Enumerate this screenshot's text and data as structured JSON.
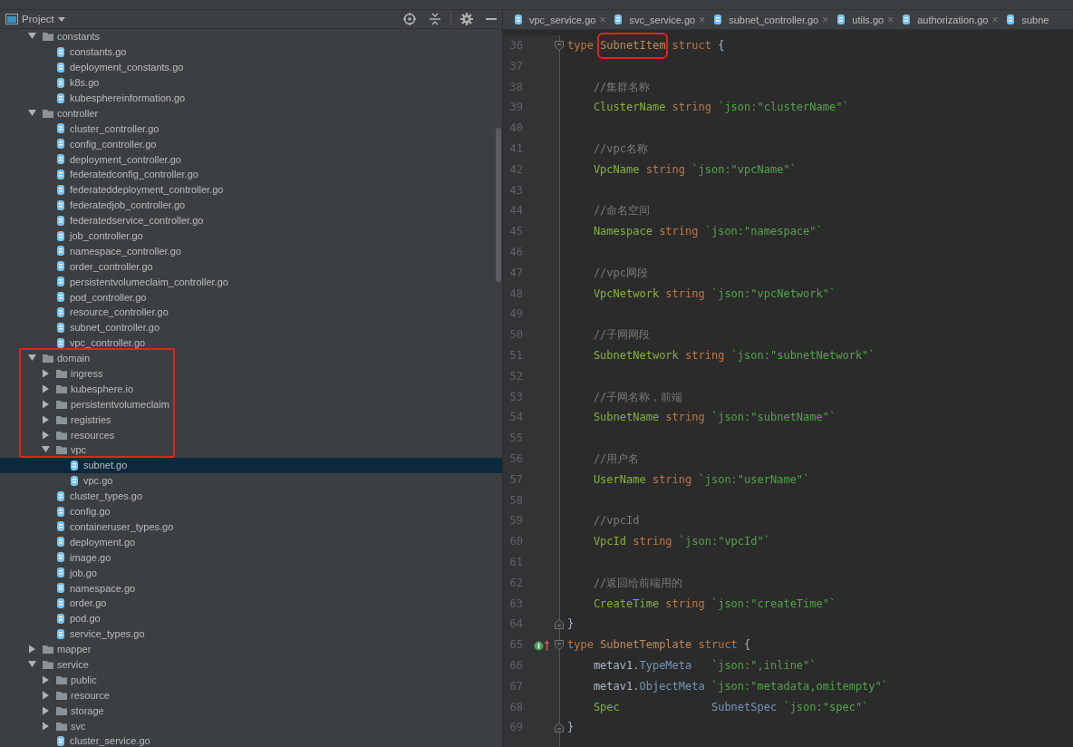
{
  "project_panel": {
    "title": "Project",
    "tree": [
      {
        "kind": "folder",
        "name": "constants",
        "expanded": true,
        "selected": false,
        "boxed": false,
        "children": [
          {
            "kind": "file",
            "name": "constants.go",
            "selected": false
          },
          {
            "kind": "file",
            "name": "deployment_constants.go",
            "selected": false
          },
          {
            "kind": "file",
            "name": "k8s.go",
            "selected": false
          },
          {
            "kind": "file",
            "name": "kubesphereinformation.go",
            "selected": false
          }
        ]
      },
      {
        "kind": "folder",
        "name": "controller",
        "expanded": true,
        "selected": false,
        "boxed": false,
        "children": [
          {
            "kind": "file",
            "name": "cluster_controller.go",
            "selected": false
          },
          {
            "kind": "file",
            "name": "config_controller.go",
            "selected": false
          },
          {
            "kind": "file",
            "name": "deployment_controller.go",
            "selected": false
          },
          {
            "kind": "file",
            "name": "federatedconfig_controller.go",
            "selected": false
          },
          {
            "kind": "file",
            "name": "federateddeployment_controller.go",
            "selected": false
          },
          {
            "kind": "file",
            "name": "federatedjob_controller.go",
            "selected": false
          },
          {
            "kind": "file",
            "name": "federatedservice_controller.go",
            "selected": false
          },
          {
            "kind": "file",
            "name": "job_controller.go",
            "selected": false
          },
          {
            "kind": "file",
            "name": "namespace_controller.go",
            "selected": false
          },
          {
            "kind": "file",
            "name": "order_controller.go",
            "selected": false
          },
          {
            "kind": "file",
            "name": "persistentvolumeclaim_controller.go",
            "selected": false
          },
          {
            "kind": "file",
            "name": "pod_controller.go",
            "selected": false
          },
          {
            "kind": "file",
            "name": "resource_controller.go",
            "selected": false
          },
          {
            "kind": "file",
            "name": "subnet_controller.go",
            "selected": false
          },
          {
            "kind": "file",
            "name": "vpc_controller.go",
            "selected": false
          }
        ]
      },
      {
        "kind": "folder",
        "name": "domain",
        "expanded": true,
        "selected": false,
        "boxed": true,
        "children": [
          {
            "kind": "folder",
            "name": "ingress",
            "expanded": false,
            "selected": false
          },
          {
            "kind": "folder",
            "name": "kubesphere.io",
            "expanded": false,
            "selected": false
          },
          {
            "kind": "folder",
            "name": "persistentvolumeclaim",
            "expanded": false,
            "selected": false
          },
          {
            "kind": "folder",
            "name": "registries",
            "expanded": false,
            "selected": false
          },
          {
            "kind": "folder",
            "name": "resources",
            "expanded": false,
            "selected": false
          },
          {
            "kind": "folder",
            "name": "vpc",
            "expanded": true,
            "selected": false,
            "children": [
              {
                "kind": "file",
                "name": "subnet.go",
                "selected": true
              },
              {
                "kind": "file",
                "name": "vpc.go",
                "selected": false
              }
            ]
          },
          {
            "kind": "file",
            "name": "cluster_types.go",
            "selected": false
          },
          {
            "kind": "file",
            "name": "config.go",
            "selected": false
          },
          {
            "kind": "file",
            "name": "containeruser_types.go",
            "selected": false
          },
          {
            "kind": "file",
            "name": "deployment.go",
            "selected": false
          },
          {
            "kind": "file",
            "name": "image.go",
            "selected": false
          },
          {
            "kind": "file",
            "name": "job.go",
            "selected": false
          },
          {
            "kind": "file",
            "name": "namespace.go",
            "selected": false
          },
          {
            "kind": "file",
            "name": "order.go",
            "selected": false
          },
          {
            "kind": "file",
            "name": "pod.go",
            "selected": false
          },
          {
            "kind": "file",
            "name": "service_types.go",
            "selected": false
          }
        ]
      },
      {
        "kind": "folder",
        "name": "mapper",
        "expanded": false,
        "selected": false,
        "boxed": false
      },
      {
        "kind": "folder",
        "name": "service",
        "expanded": true,
        "selected": false,
        "boxed": false,
        "children": [
          {
            "kind": "folder",
            "name": "public",
            "expanded": false,
            "selected": false
          },
          {
            "kind": "folder",
            "name": "resource",
            "expanded": false,
            "selected": false
          },
          {
            "kind": "folder",
            "name": "storage",
            "expanded": false,
            "selected": false
          },
          {
            "kind": "folder",
            "name": "svc",
            "expanded": false,
            "selected": false
          },
          {
            "kind": "file",
            "name": "cluster_service.go",
            "selected": false
          }
        ]
      }
    ]
  },
  "editor": {
    "tabs": [
      {
        "label": "vpc_service.go",
        "close": "×",
        "selected": false
      },
      {
        "label": "svc_service.go",
        "close": "×",
        "selected": false
      },
      {
        "label": "subnet_controller.go",
        "close": "×",
        "selected": false
      },
      {
        "label": "utils.go",
        "close": "×",
        "selected": false
      },
      {
        "label": "authorization.go",
        "close": "×",
        "selected": false
      },
      {
        "label": "subne",
        "selected": false
      }
    ],
    "lines": [
      {
        "number": "36",
        "gutter": [
          {
            "kind": "fold_start"
          }
        ],
        "tokens": [
          {
            "kind": "keyword",
            "text": "type"
          },
          {
            "kind": "decl",
            "text": "SubnetItem",
            "boxed": true
          },
          {
            "kind": "keyword",
            "text": "struct"
          },
          {
            "kind": "punct",
            "text": "{"
          }
        ]
      },
      {
        "number": "37"
      },
      {
        "number": "38",
        "tokens": [
          {
            "kind": "comment",
            "text": "//集群名称"
          }
        ]
      },
      {
        "number": "39",
        "tokens": [
          {
            "kind": "field",
            "text": "ClusterName"
          },
          {
            "kind": "keyword",
            "text": "string"
          },
          {
            "kind": "tag",
            "text": "`json:\"clusterName\"`"
          }
        ]
      },
      {
        "number": "40"
      },
      {
        "number": "41",
        "tokens": [
          {
            "kind": "comment",
            "text": "//vpc名称"
          }
        ]
      },
      {
        "number": "42",
        "tokens": [
          {
            "kind": "field",
            "text": "VpcName"
          },
          {
            "kind": "keyword",
            "text": "string"
          },
          {
            "kind": "tag",
            "text": "`json:\"vpcName\"`"
          }
        ]
      },
      {
        "number": "43"
      },
      {
        "number": "44",
        "tokens": [
          {
            "kind": "comment",
            "text": "//命名空间"
          }
        ]
      },
      {
        "number": "45",
        "tokens": [
          {
            "kind": "field",
            "text": "Namespace"
          },
          {
            "kind": "keyword",
            "text": "string"
          },
          {
            "kind": "tag",
            "text": "`json:\"namespace\"`"
          }
        ]
      },
      {
        "number": "46"
      },
      {
        "number": "47",
        "tokens": [
          {
            "kind": "comment",
            "text": "//vpc网段"
          }
        ]
      },
      {
        "number": "48",
        "tokens": [
          {
            "kind": "field",
            "text": "VpcNetwork"
          },
          {
            "kind": "keyword",
            "text": "string"
          },
          {
            "kind": "tag",
            "text": "`json:\"vpcNetwork\"`"
          }
        ]
      },
      {
        "number": "49"
      },
      {
        "number": "50",
        "tokens": [
          {
            "kind": "comment",
            "text": "//子网网段"
          }
        ]
      },
      {
        "number": "51",
        "tokens": [
          {
            "kind": "field",
            "text": "SubnetNetwork"
          },
          {
            "kind": "keyword",
            "text": "string"
          },
          {
            "kind": "tag",
            "text": "`json:\"subnetNetwork\"`"
          }
        ]
      },
      {
        "number": "52"
      },
      {
        "number": "53",
        "tokens": [
          {
            "kind": "comment",
            "text": "//子网名称，前端"
          }
        ]
      },
      {
        "number": "54",
        "tokens": [
          {
            "kind": "field",
            "text": "SubnetName"
          },
          {
            "kind": "keyword",
            "text": "string"
          },
          {
            "kind": "tag",
            "text": "`json:\"subnetName\"`"
          }
        ]
      },
      {
        "number": "55"
      },
      {
        "number": "56",
        "tokens": [
          {
            "kind": "comment",
            "text": "//用户名"
          }
        ]
      },
      {
        "number": "57",
        "tokens": [
          {
            "kind": "field",
            "text": "UserName"
          },
          {
            "kind": "keyword",
            "text": "string"
          },
          {
            "kind": "tag",
            "text": "`json:\"userName\"`"
          }
        ]
      },
      {
        "number": "58"
      },
      {
        "number": "59",
        "tokens": [
          {
            "kind": "comment",
            "text": "//vpcId"
          }
        ]
      },
      {
        "number": "60",
        "tokens": [
          {
            "kind": "field",
            "text": "VpcId"
          },
          {
            "kind": "keyword",
            "text": "string"
          },
          {
            "kind": "tag",
            "text": "`json:\"vpcId\"`"
          }
        ]
      },
      {
        "number": "61"
      },
      {
        "number": "62",
        "tokens": [
          {
            "kind": "comment",
            "text": "//返回给前端用的"
          }
        ]
      },
      {
        "number": "63",
        "tokens": [
          {
            "kind": "field",
            "text": "CreateTime"
          },
          {
            "kind": "keyword",
            "text": "string"
          },
          {
            "kind": "tag",
            "text": "`json:\"createTime\"`"
          }
        ]
      },
      {
        "number": "64",
        "gutter": [
          {
            "kind": "fold_end"
          }
        ],
        "tokens": [
          {
            "kind": "punct",
            "text": "}"
          }
        ]
      },
      {
        "number": "65",
        "gutter": [
          {
            "kind": "implements"
          },
          {
            "kind": "fold_start"
          }
        ],
        "tokens": [
          {
            "kind": "keyword",
            "text": "type"
          },
          {
            "kind": "decl",
            "text": "SubnetTemplate"
          },
          {
            "kind": "keyword",
            "text": "struct"
          },
          {
            "kind": "punct",
            "text": "{"
          }
        ]
      },
      {
        "number": "66",
        "tokens": [
          {
            "kind": "package",
            "text": "metav1."
          },
          {
            "kind": "typeref",
            "text": "TypeMeta"
          },
          {
            "kind": "tag",
            "text": "`json:\",inline\"`"
          }
        ]
      },
      {
        "number": "67",
        "tokens": [
          {
            "kind": "package",
            "text": "metav1."
          },
          {
            "kind": "typeref",
            "text": "ObjectMeta"
          },
          {
            "kind": "tag",
            "text": "`json:\"metadata,omitempty\"`"
          }
        ]
      },
      {
        "number": "68",
        "tokens": [
          {
            "kind": "field",
            "text": "Spec"
          },
          {
            "kind": "typeref",
            "text": "SubnetSpec"
          },
          {
            "kind": "tag",
            "text": "`json:\"spec\"`"
          }
        ]
      },
      {
        "number": "69",
        "gutter": [
          {
            "kind": "fold_end"
          }
        ],
        "tokens": [
          {
            "kind": "punct",
            "text": "}"
          }
        ]
      }
    ]
  }
}
